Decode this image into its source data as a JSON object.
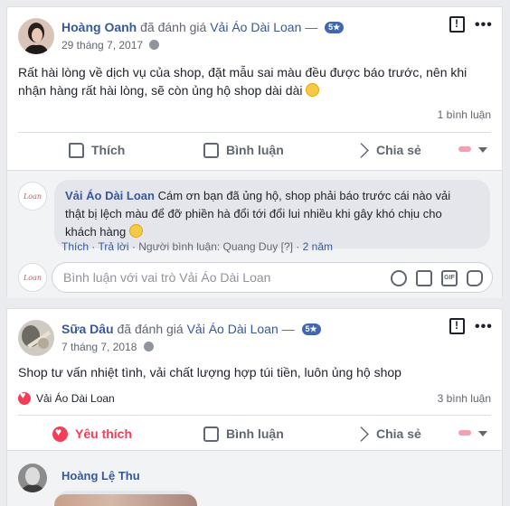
{
  "posts": [
    {
      "author": "Hoàng Oanh",
      "rated_text": "đã đánh giá",
      "page": "Vải Áo Dài Loan",
      "dash": "—",
      "rating": "5★",
      "date": "29 tháng 7, 2017",
      "text_line1": "Rất hài lòng về dịch vụ của shop, đặt mẫu sai màu đều được báo trước, nên khi",
      "text_line2": "nhận hàng rất hài lòng, sẽ còn ủng hộ shop dài dài",
      "comment_count": "1 bình luận",
      "actions": {
        "like": "Thích",
        "comment": "Bình luận",
        "share": "Chia sẻ"
      },
      "comment": {
        "author": "Vải Áo Dài Loan",
        "text_line1": "Cám ơn bạn đã ủng hộ, shop phải báo trước cái nào vải",
        "text_line2": "thật bị lệch màu để đỡ phiền hà đổi tới đổi lui nhiều khi gây khó chịu cho",
        "text_line3": "khách hàng",
        "like": "Thích",
        "reply": "Trả lời",
        "sep": "·",
        "commenter_info": "Người bình luận: Quang Duy",
        "translate_mark": "[?]",
        "time": "2 năm"
      },
      "reply_placeholder": "Bình luận với vai trò Vải Áo Dài Loan",
      "page_avatar_text": "Loan"
    },
    {
      "author": "Sữa Dâu",
      "rated_text": "đã đánh giá",
      "page": "Vải Áo Dài Loan",
      "dash": "—",
      "rating": "5★",
      "date": "7 tháng 7, 2018",
      "text": "Shop tư vấn nhiệt tình, vải chất lượng hợp túi tiền, luôn ủng hộ shop",
      "liked_by": "Vải Áo Dài Loan",
      "comment_count": "3 bình luận",
      "actions": {
        "like": "Yêu thích",
        "comment": "Bình luận",
        "share": "Chia sẻ"
      },
      "comment": {
        "author": "Hoàng Lệ Thu"
      }
    }
  ],
  "colors": {
    "link": "#385898",
    "rating_badge": "#4267b2",
    "love": "#f33e58"
  }
}
